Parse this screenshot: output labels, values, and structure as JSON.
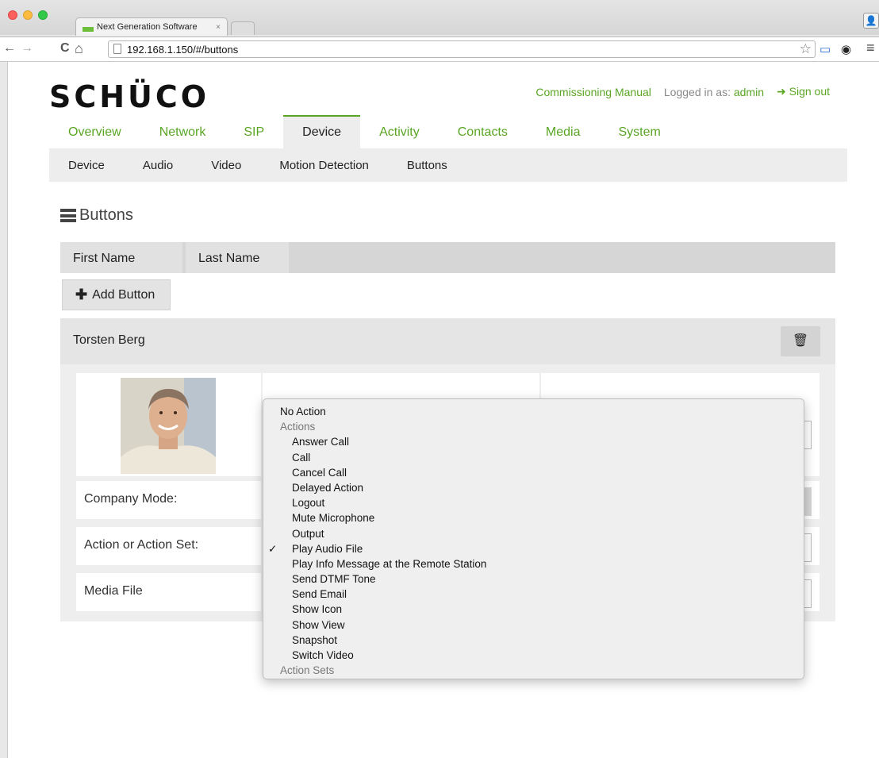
{
  "browser": {
    "tab_title": "Next Generation Software",
    "tab_close": "×",
    "url": "192.168.1.150/#/buttons",
    "back_glyph": "←",
    "forward_glyph": "→",
    "reload_glyph": "C",
    "home_glyph": "⌂",
    "bookmark_glyph": "☆",
    "cast_glyph": "▭",
    "extension_glyph": "◉",
    "menu_glyph": "≡",
    "profile_glyph": "👤"
  },
  "header": {
    "logo": "SCHÜCO",
    "manual_link": "Commissioning Manual",
    "logged_in_prefix": "Logged in as:",
    "username": "admin",
    "signout": "Sign out",
    "signout_icon": "➜"
  },
  "main_nav": [
    {
      "label": "Overview",
      "active": false
    },
    {
      "label": "Network",
      "active": false
    },
    {
      "label": "SIP",
      "active": false
    },
    {
      "label": "Device",
      "active": true
    },
    {
      "label": "Activity",
      "active": false
    },
    {
      "label": "Contacts",
      "active": false
    },
    {
      "label": "Media",
      "active": false
    },
    {
      "label": "System",
      "active": false
    }
  ],
  "sub_nav": [
    {
      "label": "Device"
    },
    {
      "label": "Audio"
    },
    {
      "label": "Video"
    },
    {
      "label": "Motion Detection"
    },
    {
      "label": "Buttons"
    }
  ],
  "section": {
    "title": "Buttons"
  },
  "table": {
    "columns": [
      "First Name",
      "Last Name"
    ],
    "add_label": "Add Button",
    "add_icon": "✚"
  },
  "entry": {
    "name": "Torsten Berg",
    "delete_icon": "🗑",
    "fields": [
      {
        "label": "Company Mode:"
      },
      {
        "label": "Action or Action Set:"
      },
      {
        "label": "Media File"
      }
    ]
  },
  "dropdown": {
    "check_glyph": "✓",
    "items": [
      {
        "label": "No Action",
        "kind": "top",
        "checked": false
      },
      {
        "label": "Actions",
        "kind": "group",
        "checked": false
      },
      {
        "label": "Answer Call",
        "kind": "option",
        "checked": false
      },
      {
        "label": "Call",
        "kind": "option",
        "checked": false
      },
      {
        "label": "Cancel Call",
        "kind": "option",
        "checked": false
      },
      {
        "label": "Delayed Action",
        "kind": "option",
        "checked": false
      },
      {
        "label": "Logout",
        "kind": "option",
        "checked": false
      },
      {
        "label": "Mute Microphone",
        "kind": "option",
        "checked": false
      },
      {
        "label": "Output",
        "kind": "option",
        "checked": false
      },
      {
        "label": "Play Audio File",
        "kind": "option",
        "checked": true
      },
      {
        "label": "Play Info Message at the Remote Station",
        "kind": "option",
        "checked": false
      },
      {
        "label": "Send DTMF Tone",
        "kind": "option",
        "checked": false
      },
      {
        "label": "Send Email",
        "kind": "option",
        "checked": false
      },
      {
        "label": "Show Icon",
        "kind": "option",
        "checked": false
      },
      {
        "label": "Show View",
        "kind": "option",
        "checked": false
      },
      {
        "label": "Snapshot",
        "kind": "option",
        "checked": false
      },
      {
        "label": "Switch Video",
        "kind": "option",
        "checked": false
      },
      {
        "label": "Action Sets",
        "kind": "group",
        "checked": false
      }
    ]
  },
  "colors": {
    "accent": "#5aa524",
    "nav_bg": "#ededed"
  }
}
